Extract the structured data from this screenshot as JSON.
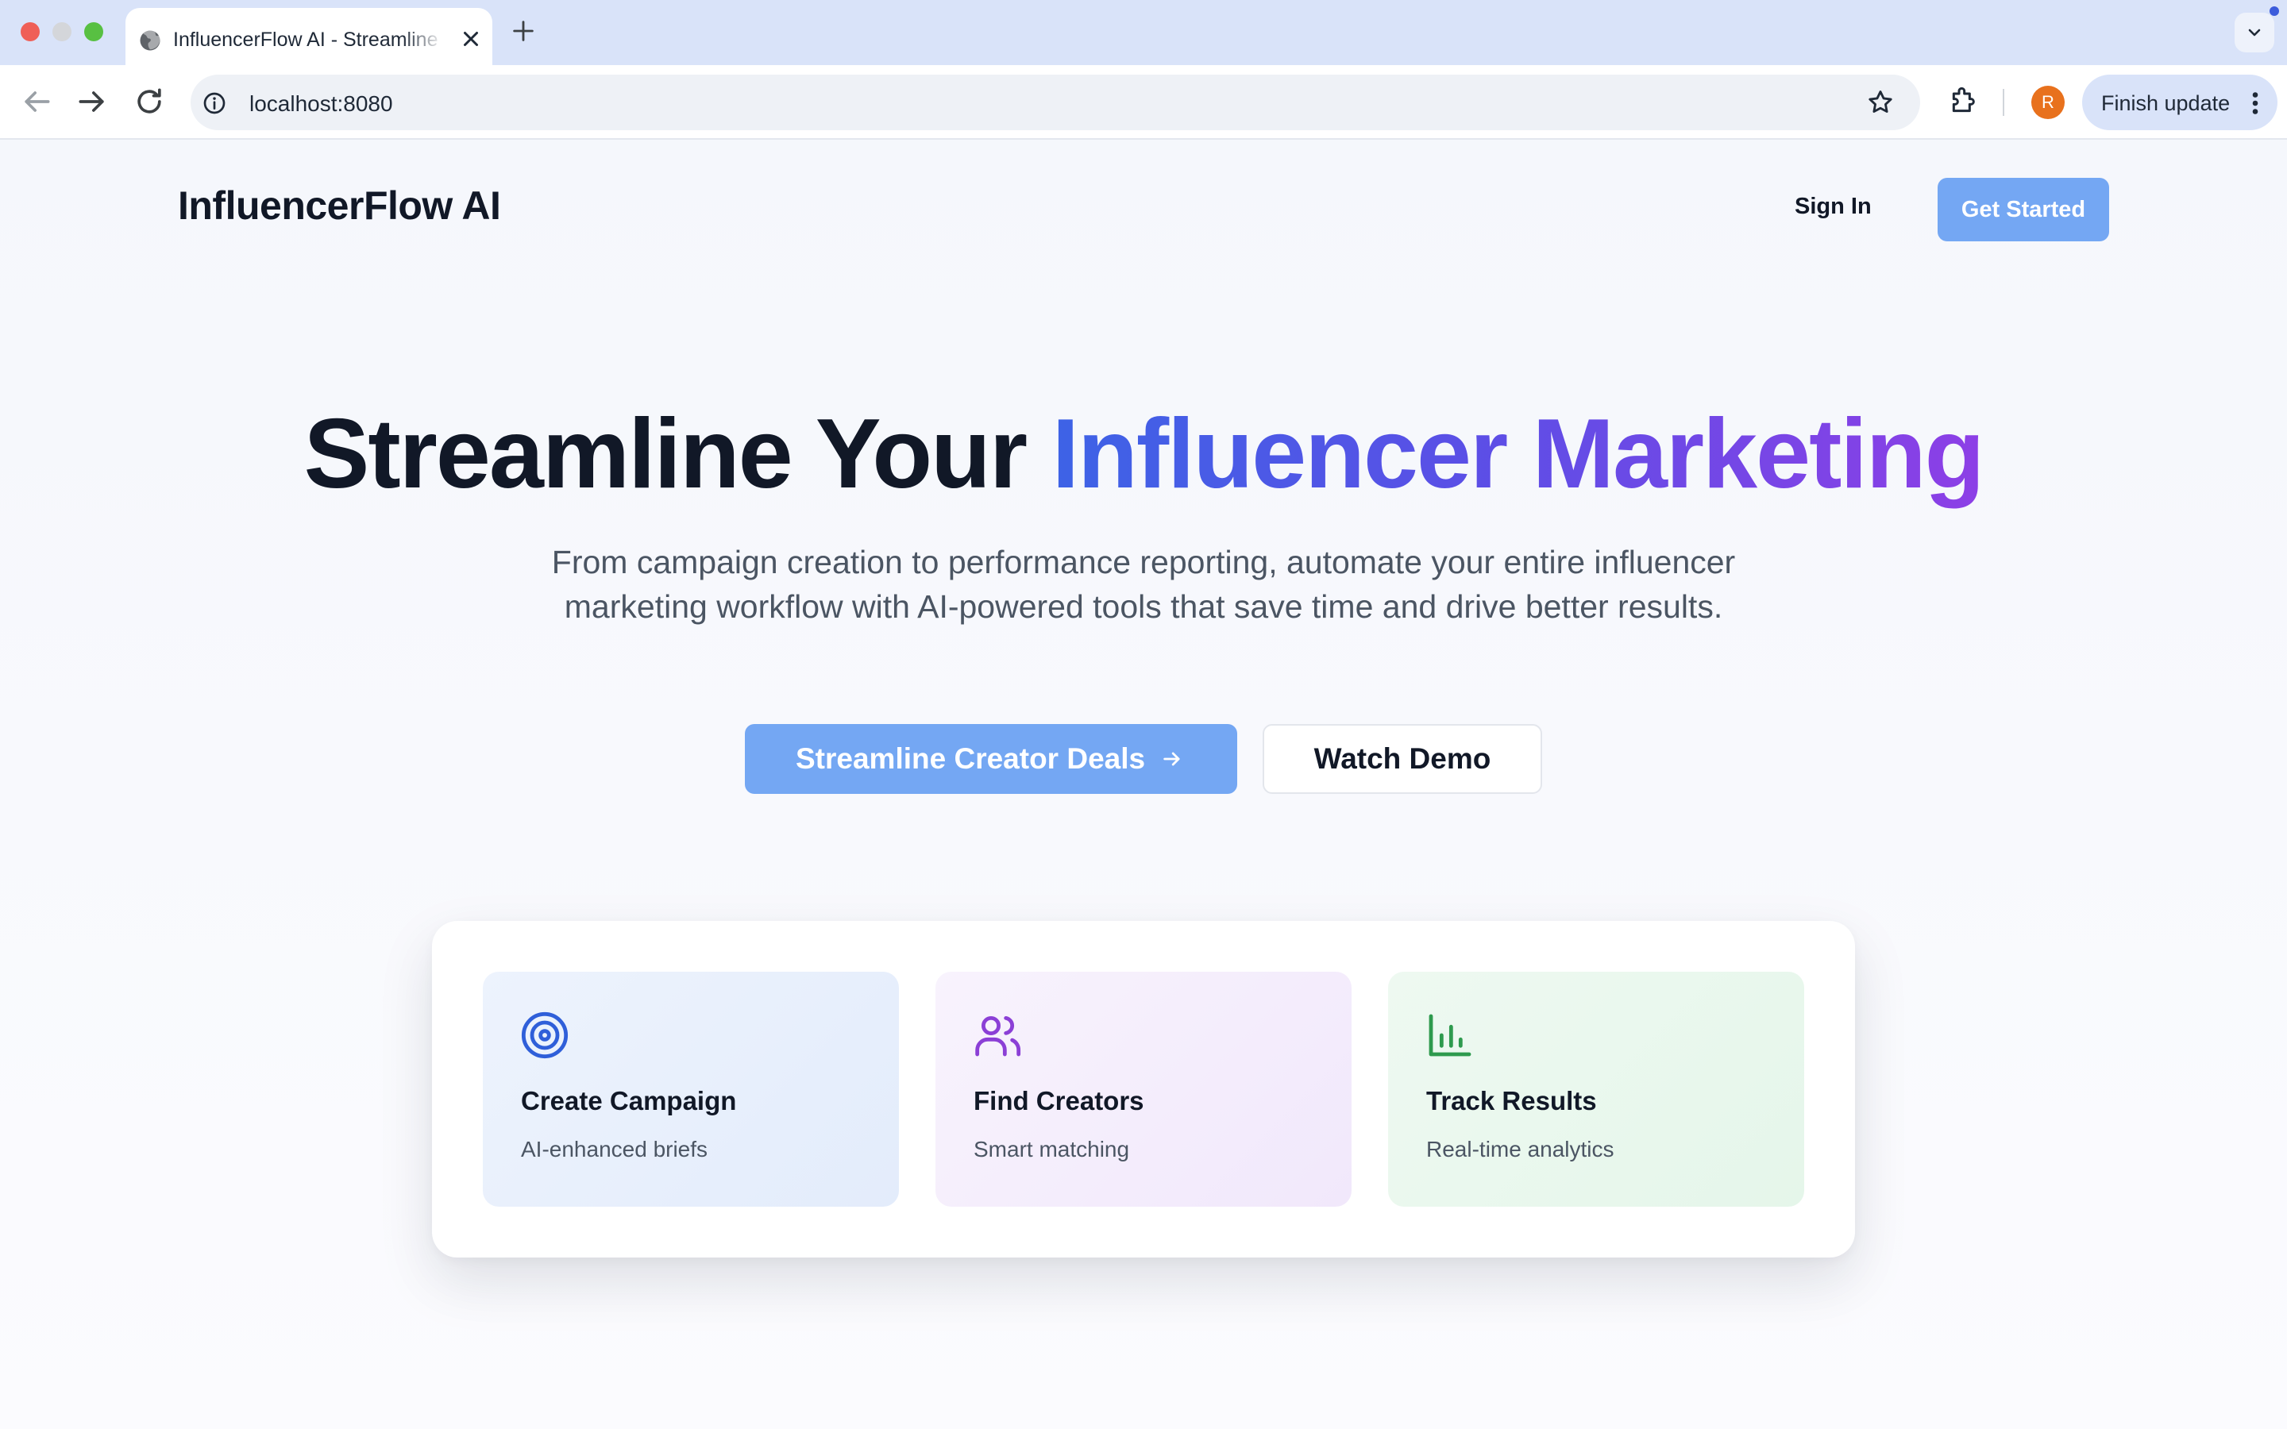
{
  "browser": {
    "tab_title": "InfluencerFlow AI - Streamline Your Influencer Marketing",
    "url": "localhost:8080",
    "profile_initial": "R",
    "update_label": "Finish update"
  },
  "header": {
    "logo": "InfluencerFlow AI",
    "sign_in": "Sign In",
    "get_started": "Get Started"
  },
  "hero": {
    "title_part1": "Streamline Your ",
    "title_part2": "Influencer Marketing",
    "subtitle": "From campaign creation to performance reporting, automate your entire influencer marketing workflow with AI-powered tools that save time and drive better results.",
    "cta_primary": "Streamline Creator Deals",
    "cta_secondary": "Watch Demo"
  },
  "features": [
    {
      "icon": "target-icon",
      "title": "Create Campaign",
      "subtitle": "AI-enhanced briefs",
      "color": "#2f5fd9"
    },
    {
      "icon": "users-icon",
      "title": "Find Creators",
      "subtitle": "Smart matching",
      "color": "#8b3fd6"
    },
    {
      "icon": "bar-chart-icon",
      "title": "Track Results",
      "subtitle": "Real-time analytics",
      "color": "#2e9a4e"
    }
  ],
  "colors": {
    "accent_blue": "#74a7f3",
    "gradient_start": "#3d63e6",
    "gradient_end": "#8d3fe6"
  }
}
